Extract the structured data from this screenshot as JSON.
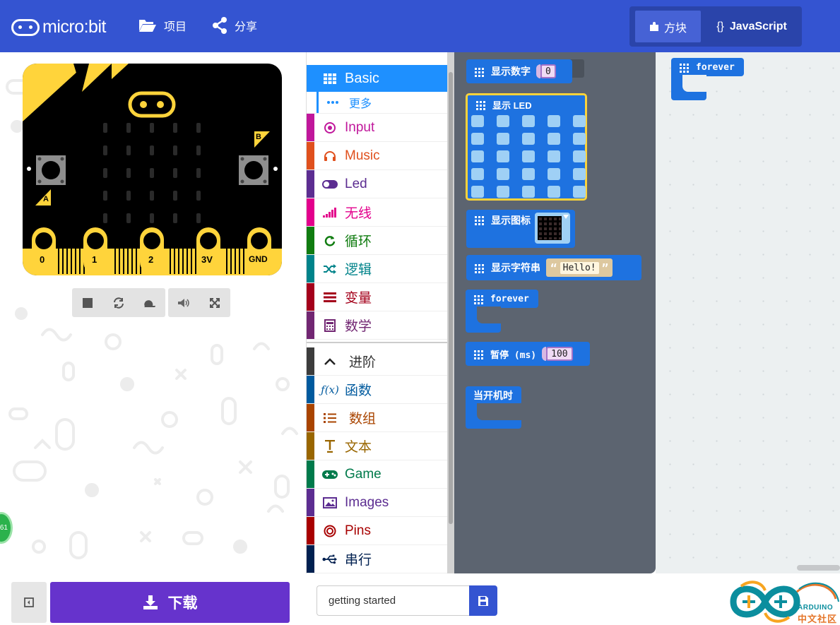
{
  "header": {
    "logo_text": "micro:bit",
    "projects_label": "项目",
    "share_label": "分享",
    "mode_blocks_label": "方块",
    "mode_js_brace": "{}",
    "mode_js_label": "JavaScript"
  },
  "simulator": {
    "pins": [
      "0",
      "1",
      "2",
      "3V",
      "GND"
    ],
    "button_a": "A",
    "button_b": "B",
    "toolbar": [
      "stop-icon",
      "restart-icon",
      "slowmo-icon",
      "mute-icon",
      "fullscreen-icon"
    ],
    "badge_text": "61"
  },
  "toolbox": {
    "categories": [
      {
        "label": "Basic",
        "color": "#1e90ff"
      },
      {
        "label": "更多",
        "color": "#1e90ff"
      },
      {
        "label": "Input",
        "color": "#c0179b"
      },
      {
        "label": "Music",
        "color": "#e0501d"
      },
      {
        "label": "Led",
        "color": "#5c2d91"
      },
      {
        "label": "无线",
        "color": "#e3008c"
      },
      {
        "label": "循环",
        "color": "#107c10"
      },
      {
        "label": "逻辑",
        "color": "#00838a"
      },
      {
        "label": "变量",
        "color": "#a4001b"
      },
      {
        "label": "数学",
        "color": "#712672"
      },
      {
        "label": "进阶",
        "color": "#3c3c3c"
      },
      {
        "label": "函数",
        "color": "#005a9e"
      },
      {
        "label": "数组",
        "color": "#a94400"
      },
      {
        "label": "文本",
        "color": "#996600"
      },
      {
        "label": "Game",
        "color": "#007a4b"
      },
      {
        "label": "Images",
        "color": "#5c2d91"
      },
      {
        "label": "Pins",
        "color": "#a80000"
      },
      {
        "label": "串行",
        "color": "#002050"
      }
    ]
  },
  "flyout": {
    "show_number": {
      "label": "显示数字",
      "value": "0"
    },
    "show_leds": {
      "label": "显示 LED"
    },
    "show_icon": {
      "label": "显示图标"
    },
    "show_string": {
      "label": "显示字符串",
      "value": "Hello!"
    },
    "forever": {
      "label": "forever"
    },
    "pause": {
      "label": "暂停 (ms)",
      "value": "100"
    },
    "on_start": {
      "label": "当开机时"
    }
  },
  "workspace": {
    "forever_block": "forever"
  },
  "footer": {
    "download_label": "下载",
    "project_name": "getting started",
    "arduino_text": "ARDUINO",
    "arduino_cn": "中文社区"
  }
}
